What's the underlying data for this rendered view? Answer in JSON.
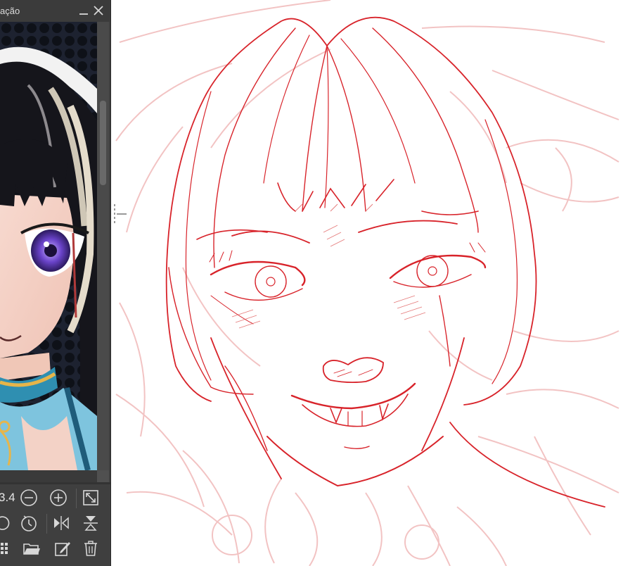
{
  "navigator": {
    "title_fragment": "ação",
    "zoom_value": "3.4",
    "buttons": {
      "zoom_out": "zoom-out",
      "zoom_in": "zoom-in",
      "fit": "fit-to-window",
      "rotate_left": "rotate-left",
      "rotate_reset": "rotate-reset",
      "flip_horizontal": "flip-horizontal",
      "flip_vertical": "flip-vertical",
      "grid": "grid",
      "open": "open-folder",
      "edit": "edit",
      "delete": "trash"
    }
  },
  "colors": {
    "panel_bg": "#3f3f3f",
    "sketch_red": "#d8232a",
    "sketch_pale": "#f0b5b5",
    "icon": "#d7d7d7"
  }
}
